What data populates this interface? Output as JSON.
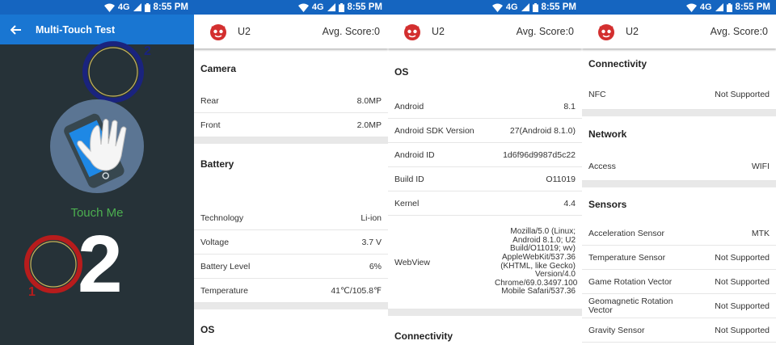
{
  "status": {
    "network": "4G",
    "time": "8:55 PM"
  },
  "multitouch": {
    "title": "Multi-Touch Test",
    "touch_label": "Touch Me",
    "point_count": "2",
    "points": [
      {
        "label": "1",
        "color": "#b71c1c"
      },
      {
        "label": "2",
        "color": "#1a237e"
      }
    ]
  },
  "app": {
    "device": "U2",
    "score": "Avg. Score:0"
  },
  "panel2": {
    "camera": {
      "title": "Camera",
      "rows": [
        {
          "key": "Rear",
          "value": "8.0MP"
        },
        {
          "key": "Front",
          "value": "2.0MP"
        }
      ]
    },
    "battery": {
      "title": "Battery",
      "rows": [
        {
          "key": "Technology",
          "value": "Li-ion"
        },
        {
          "key": "Voltage",
          "value": "3.7 V"
        },
        {
          "key": "Battery Level",
          "value": "6%"
        },
        {
          "key": "Temperature",
          "value": "41℃/105.8℉"
        }
      ]
    },
    "os_title": "OS"
  },
  "panel3": {
    "os": {
      "title": "OS",
      "rows": [
        {
          "key": "Android",
          "value": "8.1"
        },
        {
          "key": "Android SDK Version",
          "value": "27(Android 8.1.0)"
        },
        {
          "key": "Android ID",
          "value": "1d6f96d9987d5c22"
        },
        {
          "key": "Build ID",
          "value": "O11019"
        },
        {
          "key": "Kernel",
          "value": "4.4"
        },
        {
          "key": "WebView",
          "value": "Mozilla/5.0 (Linux; Android 8.1.0; U2 Build/O11019; wv) AppleWebKit/537.36 (KHTML, like Gecko) Version/4.0 Chrome/69.0.3497.100 Mobile Safari/537.36"
        }
      ]
    },
    "connectivity_title": "Connectivity"
  },
  "panel4": {
    "connectivity": {
      "title": "Connectivity",
      "rows": [
        {
          "key": "NFC",
          "value": "Not Supported"
        }
      ]
    },
    "network": {
      "title": "Network",
      "rows": [
        {
          "key": "Access",
          "value": "WIFI"
        }
      ]
    },
    "sensors": {
      "title": "Sensors",
      "rows": [
        {
          "key": "Acceleration Sensor",
          "value": "MTK"
        },
        {
          "key": "Temperature Sensor",
          "value": "Not Supported"
        },
        {
          "key": "Game Rotation Vector",
          "value": "Not Supported"
        },
        {
          "key": "Geomagnetic Rotation Vector",
          "value": "Not Supported"
        },
        {
          "key": "Gravity Sensor",
          "value": "Not Supported"
        }
      ]
    }
  },
  "colors": {
    "status_bar": "#1565c0",
    "toolbar": "#1976d2",
    "dark_bg": "#263238",
    "touch_green": "#4caf50"
  },
  "icons": [
    "wifi-icon",
    "signal-icon",
    "battery-icon",
    "back-arrow-icon",
    "antutu-logo-icon",
    "hand-touch-icon"
  ]
}
